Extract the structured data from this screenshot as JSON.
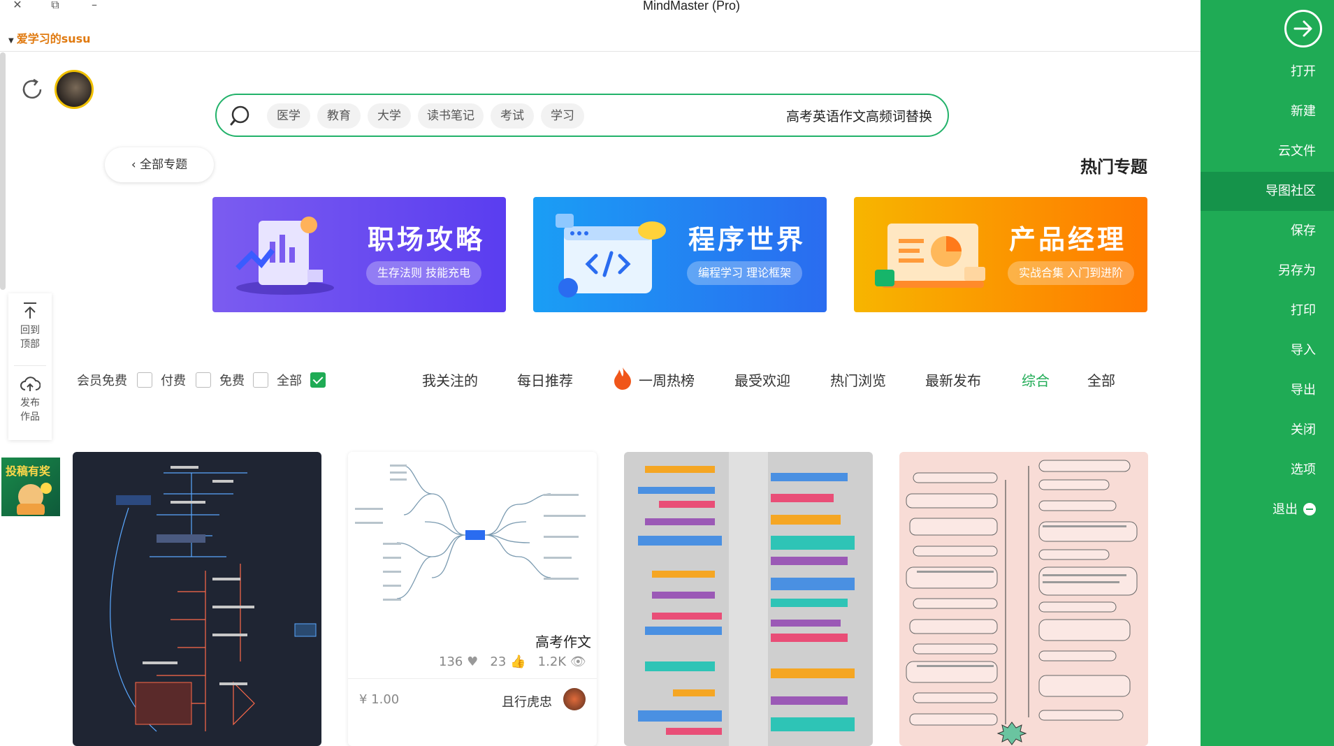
{
  "window": {
    "title": "MindMaster (Pro)",
    "close_glyph": "✕",
    "restore_glyph": "⧉",
    "minimize_glyph": "–"
  },
  "account": {
    "name": "爱学习的susu"
  },
  "sidebar": {
    "items": [
      {
        "label": "打开"
      },
      {
        "label": "新建"
      },
      {
        "label": "云文件"
      },
      {
        "label": "导图社区"
      },
      {
        "label": "保存"
      },
      {
        "label": "另存为"
      },
      {
        "label": "打印"
      },
      {
        "label": "导入"
      },
      {
        "label": "导出"
      },
      {
        "label": "关闭"
      },
      {
        "label": "选项"
      },
      {
        "label": "退出"
      }
    ],
    "active": "导图社区"
  },
  "search": {
    "tags": [
      "医学",
      "教育",
      "大学",
      "读书笔记",
      "考试",
      "学习"
    ],
    "query": "高考英语作文高频词替换"
  },
  "nav": {
    "back_label": "全部专题",
    "section_title": "热门专题"
  },
  "banners": [
    {
      "title": "职场攻略",
      "subtitle": "生存法则 技能充电"
    },
    {
      "title": "程序世界",
      "subtitle": "编程学习 理论框架"
    },
    {
      "title": "产品经理",
      "subtitle": "实战合集 入门到进阶"
    }
  ],
  "float_tools": [
    {
      "label": "回到顶部",
      "line1": "回到",
      "line2": "顶部"
    },
    {
      "label": "发布作品",
      "line1": "发布",
      "line2": "作品"
    }
  ],
  "filter_tabs": [
    "全部",
    "综合",
    "最新发布",
    "热门浏览",
    "最受欢迎",
    "一周热榜",
    "每日推荐",
    "我关注的"
  ],
  "active_tab": "综合",
  "price_filters": [
    {
      "label": "全部",
      "checked": true
    },
    {
      "label": "免费",
      "checked": false
    },
    {
      "label": "付费",
      "checked": false
    },
    {
      "label": "会员免费",
      "checked": false
    }
  ],
  "promo": {
    "text": "投稿有奖"
  },
  "card": {
    "title": "高考作文",
    "views": "1.2K",
    "likes": "23",
    "favorites": "136",
    "author": "且行虎忠",
    "price": "¥ 1.00"
  },
  "colors": {
    "accent": "#1fab55",
    "account": "#e07a10"
  }
}
